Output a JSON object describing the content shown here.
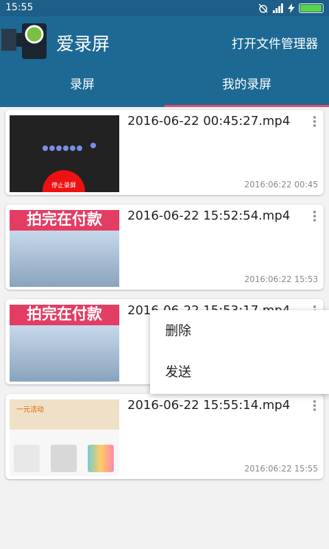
{
  "status": {
    "time": "15:55",
    "battery_level": 0.92
  },
  "appbar": {
    "title": "爱录屏",
    "open_file_manager": "打开文件管理器"
  },
  "tabs": [
    {
      "label": "录屏",
      "active": false
    },
    {
      "label": "我的录屏",
      "active": true
    }
  ],
  "colors": {
    "appbar": "#1d6994",
    "statusbar": "#1d5f88",
    "tab_indicator": "#e74b74"
  },
  "recordings": [
    {
      "filename": "2016-06-22 00:45:27.mp4",
      "date": "2016:06:22 00:45",
      "thumb_text": "停止录屏"
    },
    {
      "filename": "2016-06-22 15:52:54.mp4",
      "date": "2016:06:22 15:53",
      "thumb_text": "拍完在付款"
    },
    {
      "filename": "2016-06-22 15:53:17.mp4",
      "date": "",
      "thumb_text": "拍完在付款"
    },
    {
      "filename": "2016-06-22 15:55:14.mp4",
      "date": "2016:06:22 15:55",
      "thumb_text": "一元活动"
    }
  ],
  "popup_menu": {
    "items": [
      "删除",
      "发送"
    ]
  }
}
